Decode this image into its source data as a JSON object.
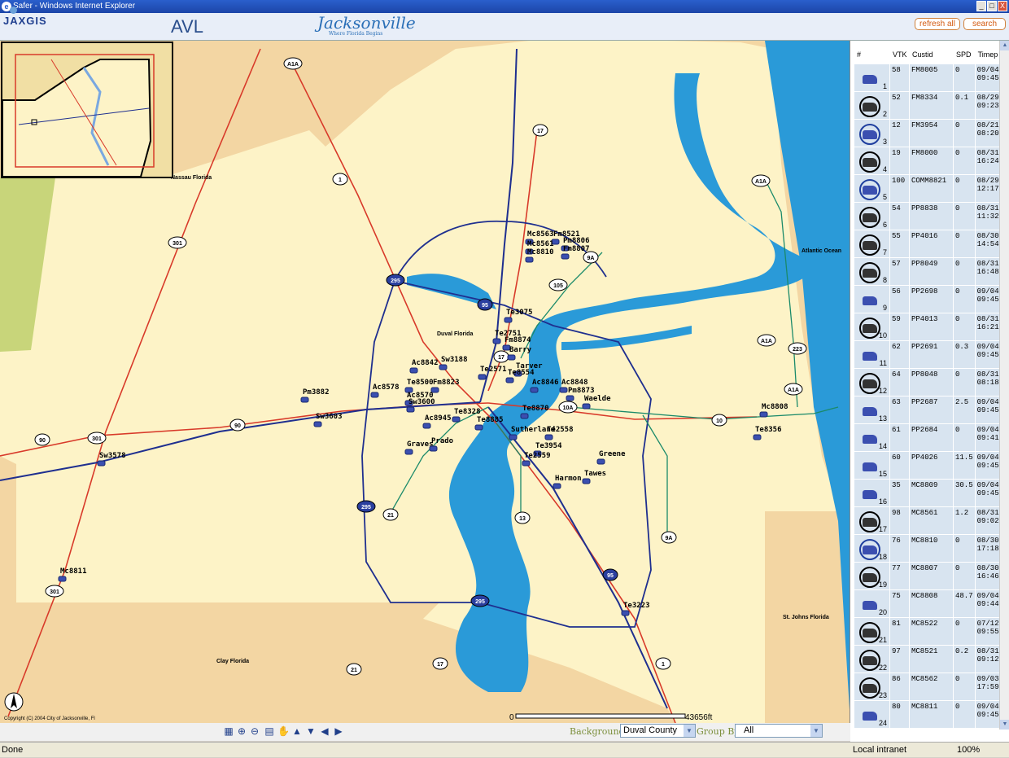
{
  "window": {
    "title": "Safer - Windows Internet Explorer",
    "controls": [
      "_",
      "□",
      "X"
    ]
  },
  "header": {
    "logo_text": "JAXGIS",
    "app_title": "AVL",
    "city_logo": "Jacksonville",
    "city_tagline": "Where Florida Begins",
    "refresh_label": "refresh all",
    "search_label": "search"
  },
  "map": {
    "places": [
      {
        "name": "Nassau Florida"
      },
      {
        "name": "Atlantic Ocean"
      },
      {
        "name": "Duval Florida"
      },
      {
        "name": "Clay Florida"
      },
      {
        "name": "St. Johns Florida"
      }
    ],
    "vehicle_labels": [
      "Mc8563",
      "Fm8521",
      "Mc8561",
      "Pm8806",
      "Mc8810",
      "Fm8807",
      "Te3075",
      "Te2751",
      "Fm8874",
      "Barry",
      "Tarver",
      "Ac8842",
      "Sw3188",
      "Te2571",
      "Te8554",
      "Ac8846",
      "Ac8848",
      "Pm8873",
      "Waelde",
      "Te8500",
      "Fm8823",
      "Ac8578",
      "Pm3882",
      "Ac8570",
      "Sw3600",
      "Te8328",
      "Ac8945",
      "Sw3603",
      "Te8885",
      "Sutherland",
      "Te2558",
      "Te8870",
      "Graves",
      "Prado",
      "Te3954",
      "Te2559",
      "Greene",
      "Harmon",
      "Tawes",
      "Mc8808",
      "Te8356",
      "Sw3578",
      "Mc8811",
      "Te3223"
    ],
    "route_shields": [
      "A1A",
      "17",
      "1",
      "301",
      "295",
      "95",
      "105",
      "9A",
      "10A",
      "10",
      "90",
      "17",
      "223",
      "A1A",
      "A1A",
      "A1A",
      "21",
      "13",
      "9A",
      "95",
      "295",
      "1",
      "17",
      "21",
      "301",
      "301",
      "90",
      "295"
    ],
    "copyright": "Copyright (C) 2004 City of Jacksonville, Fl",
    "scale_start": "0",
    "scale_end": "43656ft"
  },
  "toolbar": {
    "tools": [
      "layers-icon",
      "zoom-in-icon",
      "zoom-out-icon",
      "print-icon",
      "pan-hand-icon",
      "pan-up-icon",
      "pan-down-icon",
      "pan-left-icon",
      "pan-right-icon"
    ],
    "backgrounds_label": "Backgrounds:",
    "backgrounds_value": "Duval County",
    "groupby_label": "Group By:",
    "groupby_value": "All"
  },
  "vehicle_table": {
    "columns": [
      "#",
      "VTK",
      "Custid",
      "SPD",
      "Timep"
    ],
    "rows": [
      {
        "num": "1",
        "vtk": "58",
        "custid": "FM8005",
        "spd": "0",
        "time": [
          "09/04",
          "09:45"
        ],
        "style": "none"
      },
      {
        "num": "2",
        "vtk": "52",
        "custid": "FM8334",
        "spd": "0.1",
        "time": [
          "08/29/",
          "09:23"
        ],
        "style": "dark"
      },
      {
        "num": "3",
        "vtk": "12",
        "custid": "FM3954",
        "spd": "0",
        "time": [
          "08/21/",
          "08:20"
        ],
        "style": "blue"
      },
      {
        "num": "4",
        "vtk": "19",
        "custid": "FM8000",
        "spd": "0",
        "time": [
          "08/31/",
          "16:24"
        ],
        "style": "dark"
      },
      {
        "num": "5",
        "vtk": "100",
        "custid": "COMM8821",
        "spd": "0",
        "time": [
          "08/29/",
          "12:17"
        ],
        "style": "blue"
      },
      {
        "num": "6",
        "vtk": "54",
        "custid": "PP8838",
        "spd": "0",
        "time": [
          "08/31/",
          "11:32"
        ],
        "style": "dark"
      },
      {
        "num": "7",
        "vtk": "55",
        "custid": "PP4016",
        "spd": "0",
        "time": [
          "08/30/",
          "14:54"
        ],
        "style": "dark"
      },
      {
        "num": "8",
        "vtk": "57",
        "custid": "PP8049",
        "spd": "0",
        "time": [
          "08/31/",
          "16:48"
        ],
        "style": "dark"
      },
      {
        "num": "9",
        "vtk": "56",
        "custid": "PP2698",
        "spd": "0",
        "time": [
          "09/04",
          "09:45"
        ],
        "style": "none"
      },
      {
        "num": "10",
        "vtk": "59",
        "custid": "PP4013",
        "spd": "0",
        "time": [
          "08/31/",
          "16:21"
        ],
        "style": "dark"
      },
      {
        "num": "11",
        "vtk": "62",
        "custid": "PP2691",
        "spd": "0.3",
        "time": [
          "09/04",
          "09:45"
        ],
        "style": "none"
      },
      {
        "num": "12",
        "vtk": "64",
        "custid": "PP8048",
        "spd": "0",
        "time": [
          "08/31/",
          "08:18"
        ],
        "style": "dark"
      },
      {
        "num": "13",
        "vtk": "63",
        "custid": "PP2687",
        "spd": "2.5",
        "time": [
          "09/04",
          "09:45"
        ],
        "style": "none"
      },
      {
        "num": "14",
        "vtk": "61",
        "custid": "PP2684",
        "spd": "0",
        "time": [
          "09/04",
          "09:41"
        ],
        "style": "none"
      },
      {
        "num": "15",
        "vtk": "60",
        "custid": "PP4026",
        "spd": "11.5",
        "time": [
          "09/04",
          "09:45"
        ],
        "style": "none"
      },
      {
        "num": "16",
        "vtk": "35",
        "custid": "MC8809",
        "spd": "30.5",
        "time": [
          "09/04",
          "09:45"
        ],
        "style": "none"
      },
      {
        "num": "17",
        "vtk": "98",
        "custid": "MC8561",
        "spd": "1.2",
        "time": [
          "08/31/",
          "09:02"
        ],
        "style": "dark"
      },
      {
        "num": "18",
        "vtk": "76",
        "custid": "MC8810",
        "spd": "0",
        "time": [
          "08/30/",
          "17:18"
        ],
        "style": "blue"
      },
      {
        "num": "19",
        "vtk": "77",
        "custid": "MC8807",
        "spd": "0",
        "time": [
          "08/30/",
          "16:46"
        ],
        "style": "dark"
      },
      {
        "num": "20",
        "vtk": "75",
        "custid": "MC8808",
        "spd": "48.7",
        "time": [
          "09/04",
          "09:44"
        ],
        "style": "none"
      },
      {
        "num": "21",
        "vtk": "81",
        "custid": "MC8522",
        "spd": "0",
        "time": [
          "07/12/",
          "09:55"
        ],
        "style": "dark"
      },
      {
        "num": "22",
        "vtk": "97",
        "custid": "MC8521",
        "spd": "0.2",
        "time": [
          "08/31/",
          "09:12"
        ],
        "style": "dark"
      },
      {
        "num": "23",
        "vtk": "86",
        "custid": "MC8562",
        "spd": "0",
        "time": [
          "09/03/",
          "17:59"
        ],
        "style": "dark"
      },
      {
        "num": "24",
        "vtk": "80",
        "custid": "MC8811",
        "spd": "0",
        "time": [
          "09/04",
          "09:45"
        ],
        "style": "none"
      }
    ]
  },
  "statusbar": {
    "status": "Done",
    "zone": "Local intranet",
    "zoom": "100%"
  },
  "colors": {
    "water": "#2a9ad8",
    "land_duval": "#fdf3c7",
    "land_outside": "#f3d6a3",
    "interstate": "#1f2f8f",
    "us_highway": "#d83a2a",
    "state_road": "#1a8a6a",
    "vehicle": "#3b4fb0"
  }
}
